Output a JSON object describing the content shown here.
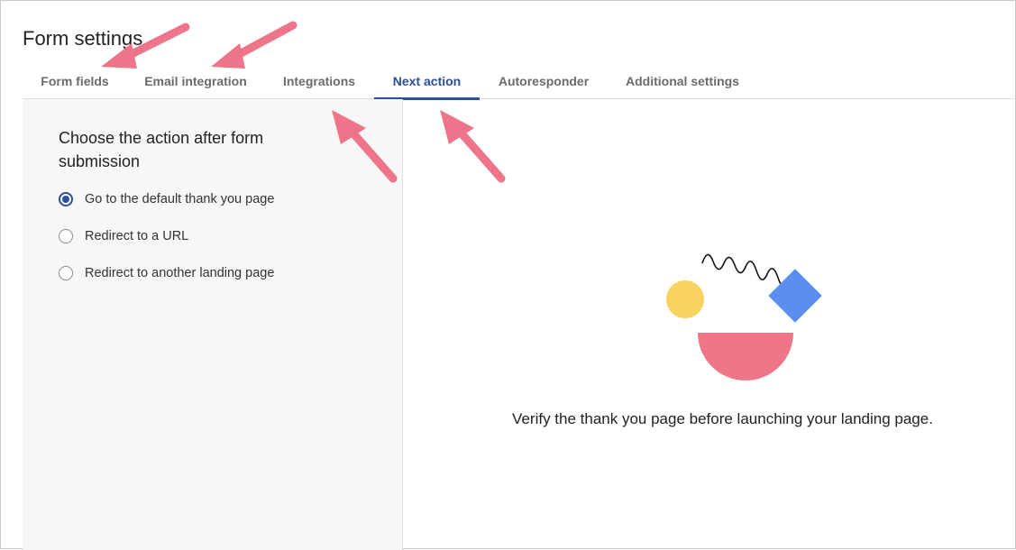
{
  "page": {
    "title": "Form settings"
  },
  "tabs": [
    {
      "label": "Form fields",
      "active": false
    },
    {
      "label": "Email integration",
      "active": false
    },
    {
      "label": "Integrations",
      "active": false
    },
    {
      "label": "Next action",
      "active": true
    },
    {
      "label": "Autoresponder",
      "active": false
    },
    {
      "label": "Additional settings",
      "active": false
    }
  ],
  "next_action": {
    "heading": "Choose the action after form submission",
    "options": [
      {
        "label": "Go to the default thank you page",
        "selected": true
      },
      {
        "label": "Redirect to a URL",
        "selected": false
      },
      {
        "label": "Redirect to another landing page",
        "selected": false
      }
    ]
  },
  "preview": {
    "message": "Verify the thank you page before launching your landing page.",
    "illustration": "decorative-shapes-icon"
  },
  "colors": {
    "accent": "#2a4f9e",
    "annotation_arrow": "#ee7589",
    "shape_yellow": "#f7d25d",
    "shape_blue": "#5b8ef0",
    "shape_pink": "#ef7589"
  }
}
